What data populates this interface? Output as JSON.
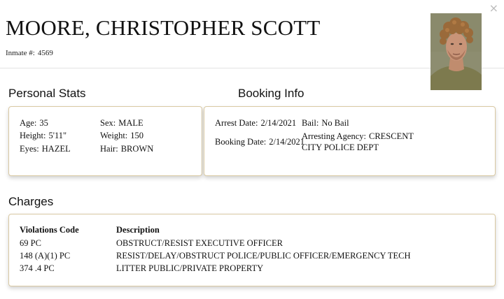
{
  "header": {
    "name": "MOORE, CHRISTOPHER SCOTT",
    "inmate_label": "Inmate #:",
    "inmate_number": "4569",
    "close_glyph": "×"
  },
  "personal": {
    "title": "Personal Stats",
    "age_label": "Age:",
    "age": "35",
    "height_label": "Height:",
    "height": "5'11\"",
    "eyes_label": "Eyes:",
    "eyes": "HAZEL",
    "sex_label": "Sex:",
    "sex": "MALE",
    "weight_label": "Weight:",
    "weight": "150",
    "hair_label": "Hair:",
    "hair": "BROWN"
  },
  "booking": {
    "title": "Booking Info",
    "arrest_label": "Arrest Date:",
    "arrest_date": "2/14/2021",
    "booking_label": "Booking Date:",
    "booking_date": "2/14/2021",
    "bail_label": "Bail:",
    "bail": "No Bail",
    "agency_label": "Arresting Agency:",
    "agency": "CRESCENT CITY POLICE DEPT"
  },
  "charges": {
    "title": "Charges",
    "headers": [
      "Violations Code",
      "Description"
    ],
    "rows": [
      {
        "code": "69 PC",
        "description": "OBSTRUCT/RESIST EXECUTIVE OFFICER"
      },
      {
        "code": "148 (A)(1) PC",
        "description": "RESIST/DELAY/OBSTRUCT POLICE/PUBLIC OFFICER/EMERGENCY TECH"
      },
      {
        "code": "374 .4 PC",
        "description": "LITTER PUBLIC/PRIVATE PROPERTY"
      }
    ]
  },
  "colors": {
    "card_border": "#d9c9a3",
    "text": "#111111"
  }
}
